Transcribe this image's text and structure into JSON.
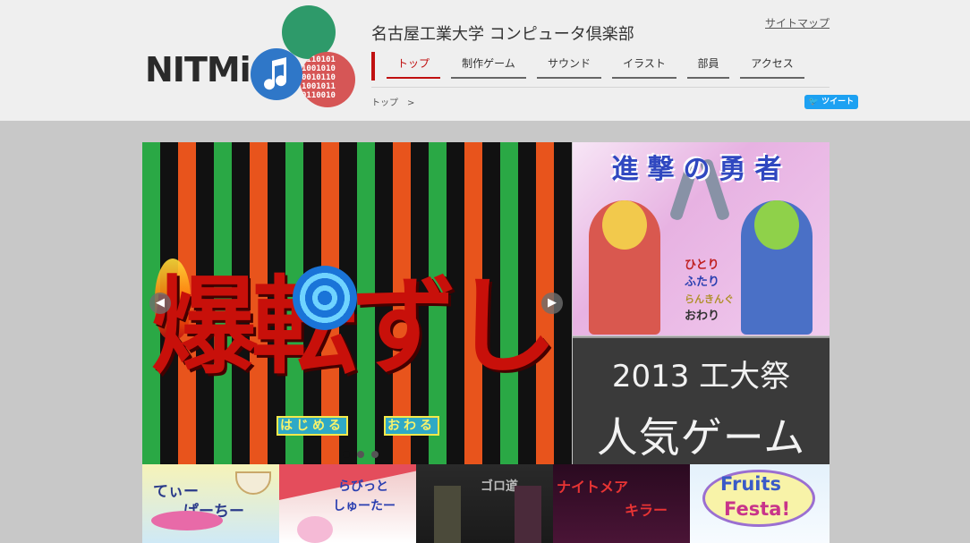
{
  "header": {
    "logo_text": "NITMiC",
    "logo_binary": "0110101\n1001010\n0010110\n1001011\n0110010",
    "site_title": "名古屋工業大学 コンピュータ倶楽部",
    "sitemap_label": "サイトマップ"
  },
  "nav": {
    "items": [
      {
        "label": "トップ",
        "active": true
      },
      {
        "label": "制作ゲーム"
      },
      {
        "label": "サウンド"
      },
      {
        "label": "イラスト"
      },
      {
        "label": "部員"
      },
      {
        "label": "アクセス"
      }
    ]
  },
  "breadcrumb": {
    "current": "トップ",
    "separator": ">"
  },
  "tweet_label": "ツイート",
  "slider": {
    "title": "爆転ずし",
    "start_label": "はじめる",
    "quit_label": "おわる",
    "prev_icon": "chevron-left-icon",
    "next_icon": "chevron-right-icon",
    "dot_count": 3,
    "active_dot": 0
  },
  "promo": {
    "game_title": "進撃の勇者",
    "modes": [
      "ひとり",
      "ふたり",
      "らんきんぐ",
      "おわり"
    ],
    "year_label": "2013 工大祭",
    "popular_label": "人気ゲーム"
  },
  "thumbs": [
    {
      "label1": "てぃー",
      "label2": "ぱーちー"
    },
    {
      "label1": "らびっと",
      "label2": "しゅーたー"
    },
    {
      "label1": "ゴロ道"
    },
    {
      "label1": "ナイトメア",
      "label2": "キラー"
    },
    {
      "label1": "Fruits",
      "label2": "Festa!"
    }
  ],
  "colors": {
    "accent": "#c01010",
    "tweet": "#1da1f2"
  }
}
